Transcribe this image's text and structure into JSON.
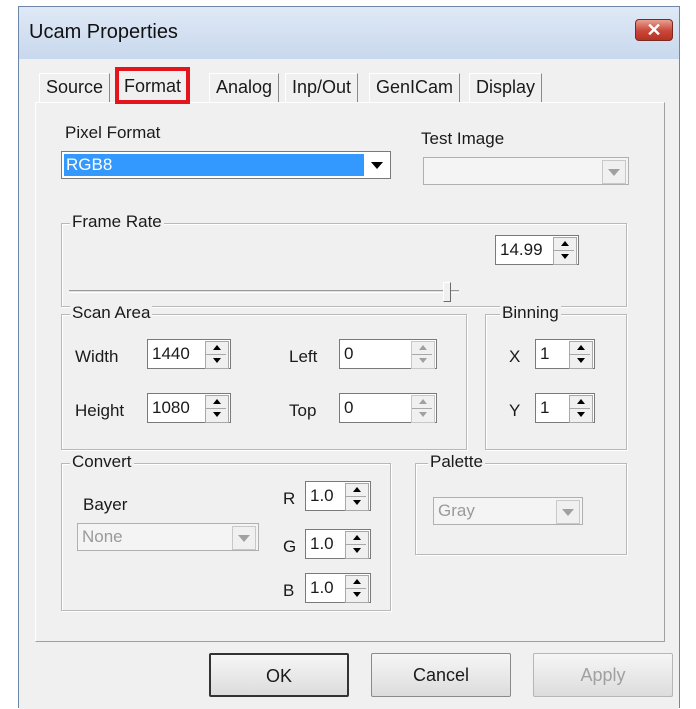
{
  "window": {
    "title": "Ucam Properties",
    "close_glyph": "✕"
  },
  "tabs": [
    {
      "label": "Source"
    },
    {
      "label": "Format",
      "selected": true,
      "highlight_color": "#e3141b"
    },
    {
      "label": "Analog"
    },
    {
      "label": "Inp/Out"
    },
    {
      "label": "GenICam"
    },
    {
      "label": "Display"
    }
  ],
  "format": {
    "pixel_format": {
      "label": "Pixel Format",
      "value": "RGB8",
      "selection_color": "#3399ff"
    },
    "test_image": {
      "label": "Test Image",
      "value": ""
    },
    "frame_rate": {
      "label": "Frame Rate",
      "value": "14.99",
      "slider_fraction": 0.97
    },
    "scan_area": {
      "label": "Scan Area",
      "width_label": "Width",
      "width": "1440",
      "height_label": "Height",
      "height": "1080",
      "left_label": "Left",
      "left": "0",
      "top_label": "Top",
      "top": "0"
    },
    "binning": {
      "label": "Binning",
      "x_label": "X",
      "x": "1",
      "y_label": "Y",
      "y": "1"
    },
    "convert": {
      "label": "Convert",
      "bayer_label": "Bayer",
      "bayer_value": "None",
      "r_label": "R",
      "r": "1.0",
      "g_label": "G",
      "g": "1.0",
      "b_label": "B",
      "b": "1.0"
    },
    "palette": {
      "label": "Palette",
      "value": "Gray"
    }
  },
  "buttons": {
    "ok": "OK",
    "cancel": "Cancel",
    "apply": "Apply"
  }
}
